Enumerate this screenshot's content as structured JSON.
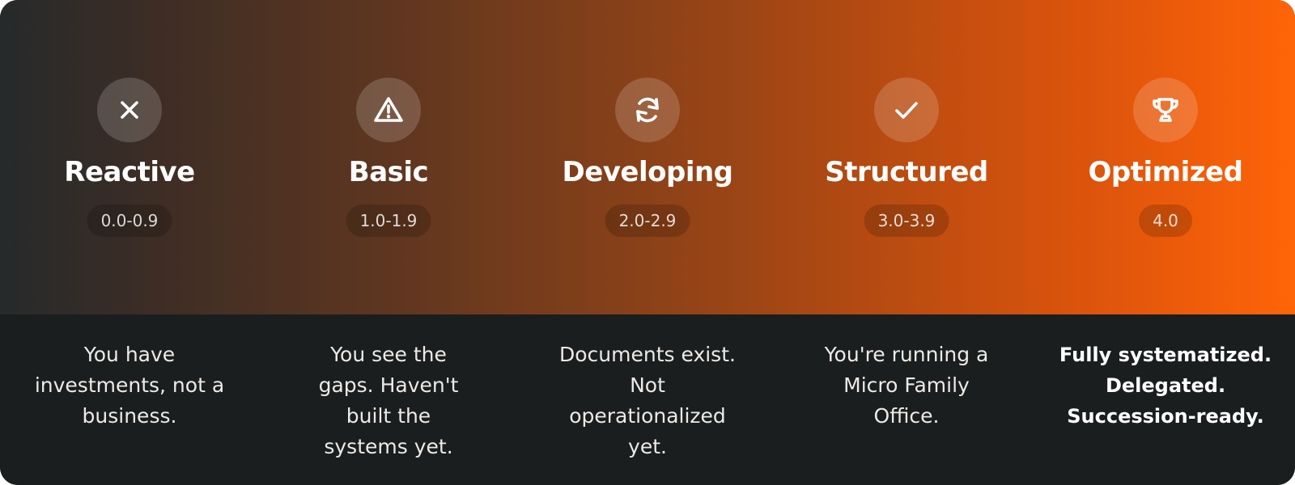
{
  "stages": [
    {
      "title": "Reactive",
      "range": "0.0-0.9",
      "icon": "x-icon",
      "description": [
        "You have",
        "investments, not a",
        "business."
      ]
    },
    {
      "title": "Basic",
      "range": "1.0-1.9",
      "icon": "warning-triangle-icon",
      "description": [
        "You see the",
        "gaps. Haven't",
        "built the",
        "systems yet."
      ]
    },
    {
      "title": "Developing",
      "range": "2.0-2.9",
      "icon": "refresh-icon",
      "description": [
        "Documents exist.",
        "Not",
        "operationalized",
        "yet."
      ]
    },
    {
      "title": "Structured",
      "range": "3.0-3.9",
      "icon": "checkmark-icon",
      "description": [
        "You're running a",
        "Micro Family",
        "Office."
      ]
    },
    {
      "title": "Optimized",
      "range": "4.0",
      "icon": "trophy-icon",
      "description": [
        "Fully systematized.",
        "Delegated.",
        "Succession-ready."
      ]
    }
  ],
  "colors": {
    "gradient_start": "#262a2b",
    "gradient_end": "#ff6408",
    "panel_background": "#1b1e1f",
    "text": "#ffffff"
  }
}
